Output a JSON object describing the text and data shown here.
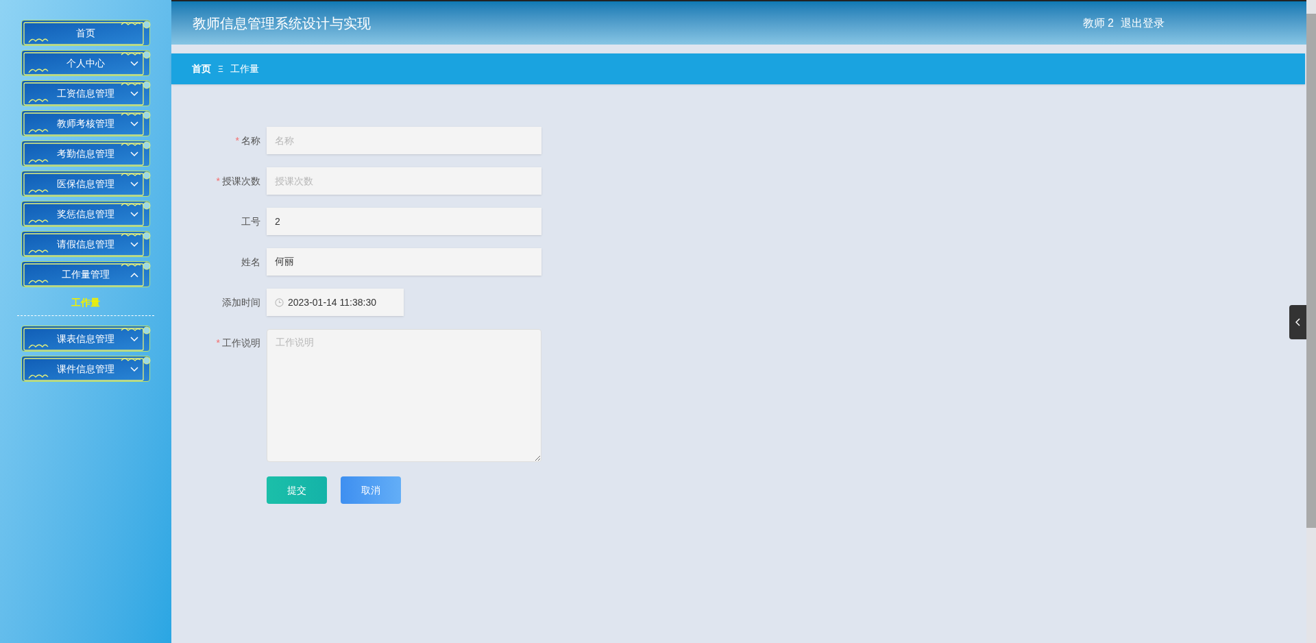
{
  "header": {
    "title": "教师信息管理系统设计与实现",
    "user": "教师 2",
    "logout": "退出登录"
  },
  "sidebar": {
    "items": [
      {
        "label": "首页",
        "kind": "link"
      },
      {
        "label": "个人中心",
        "kind": "menu",
        "expanded": false
      },
      {
        "label": "工资信息管理",
        "kind": "menu",
        "expanded": false
      },
      {
        "label": "教师考核管理",
        "kind": "menu",
        "expanded": false
      },
      {
        "label": "考勤信息管理",
        "kind": "menu",
        "expanded": false
      },
      {
        "label": "医保信息管理",
        "kind": "menu",
        "expanded": false
      },
      {
        "label": "奖惩信息管理",
        "kind": "menu",
        "expanded": false
      },
      {
        "label": "请假信息管理",
        "kind": "menu",
        "expanded": false
      },
      {
        "label": "工作量管理",
        "kind": "menu",
        "expanded": true,
        "children": [
          {
            "label": "工作量",
            "selected": true
          }
        ]
      },
      {
        "label": "课表信息管理",
        "kind": "menu",
        "expanded": false
      },
      {
        "label": "课件信息管理",
        "kind": "menu",
        "expanded": false
      }
    ]
  },
  "breadcrumb": {
    "items": [
      "首页",
      "工作量"
    ],
    "separator": "Ξ"
  },
  "form": {
    "required_mark": "*",
    "fields": [
      {
        "label": "名称",
        "kind": "input",
        "required": true,
        "placeholder": "名称"
      },
      {
        "label": "授课次数",
        "kind": "input",
        "required": true,
        "placeholder": "授课次数"
      },
      {
        "label": "工号",
        "kind": "input",
        "required": false,
        "value": "2"
      },
      {
        "label": "姓名",
        "kind": "input",
        "required": false,
        "value": "何丽"
      },
      {
        "label": "添加时间",
        "kind": "date",
        "required": false,
        "value": "2023-01-14 11:38:30"
      },
      {
        "label": "工作说明",
        "kind": "textarea",
        "required": true,
        "placeholder": "工作说明"
      }
    ],
    "buttons": [
      {
        "label": "提交",
        "kind": "submit"
      },
      {
        "label": "取消",
        "kind": "cancel"
      }
    ]
  }
}
